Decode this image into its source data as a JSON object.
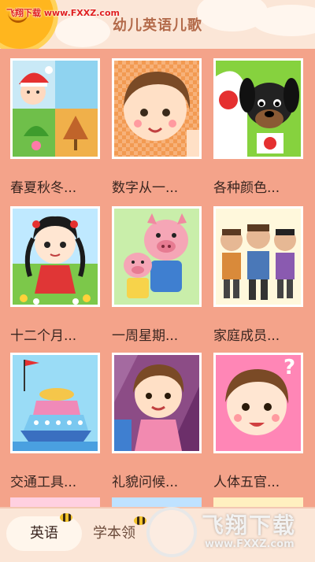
{
  "header": {
    "watermark": "飞翔下载 www.FXXZ.com",
    "title": "幼儿英语儿歌"
  },
  "grid": {
    "items": [
      {
        "label": "春夏秋冬...",
        "icon": "seasons-illustration"
      },
      {
        "label": "数字从一...",
        "icon": "girl-counting-illustration"
      },
      {
        "label": "各种颜色...",
        "icon": "dog-illustration"
      },
      {
        "label": "十二个月...",
        "icon": "girl-with-pigtails-illustration"
      },
      {
        "label": "一周星期...",
        "icon": "pigs-illustration"
      },
      {
        "label": "家庭成员...",
        "icon": "family-illustration"
      },
      {
        "label": "交通工具...",
        "icon": "ship-illustration"
      },
      {
        "label": "礼貌问候...",
        "icon": "greeting-girl-illustration"
      },
      {
        "label": "人体五官...",
        "icon": "face-girl-illustration"
      }
    ]
  },
  "tabbar": {
    "tabs": [
      {
        "label": "英语",
        "active": true
      },
      {
        "label": "学本领",
        "active": false
      }
    ]
  },
  "watermark_logo": {
    "text": "飞翔下载",
    "url": "www.FXXZ.com"
  },
  "colors": {
    "background": "#f4a38a",
    "header": "#fbe6d7",
    "accent_sun": "#ffb61e"
  }
}
